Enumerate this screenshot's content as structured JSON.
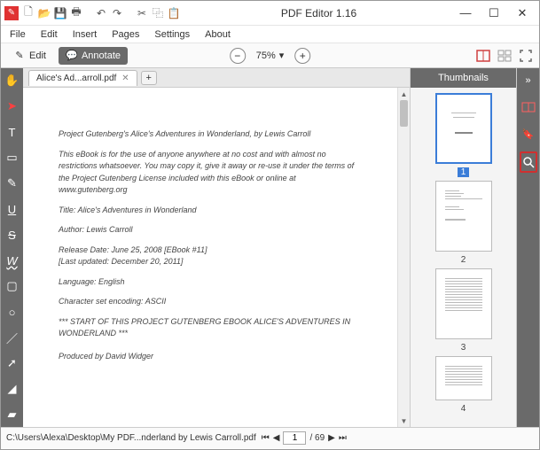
{
  "app": {
    "title": "PDF Editor 1.16"
  },
  "menu": {
    "items": [
      "File",
      "Edit",
      "Insert",
      "Pages",
      "Settings",
      "About"
    ]
  },
  "toolbar": {
    "edit": "Edit",
    "annotate": "Annotate",
    "zoom": "75%"
  },
  "tab": {
    "label": "Alice's Ad...arroll.pdf"
  },
  "doc": {
    "p1": "Project Gutenberg's Alice's Adventures in Wonderland, by Lewis Carroll",
    "p2": "This eBook is for the use of anyone anywhere at no cost and with almost no restrictions whatsoever.  You may copy it, give it away or re-use it under the terms of the Project Gutenberg License included with this eBook or online at www.gutenberg.org",
    "p3": "Title: Alice's Adventures in Wonderland",
    "p4": "Author: Lewis Carroll",
    "p5": "Release Date: June 25, 2008 [EBook #11]",
    "p6": "[Last updated: December 20, 2011]",
    "p7": "Language: English",
    "p8": "Character set encoding: ASCII",
    "p9": "*** START OF THIS PROJECT GUTENBERG EBOOK ALICE'S ADVENTURES IN WONDERLAND ***",
    "p10": "Produced by David Widger"
  },
  "thumbs": {
    "header": "Thumbnails",
    "n1": "1",
    "n2": "2",
    "n3": "3",
    "n4": "4"
  },
  "status": {
    "path": "C:\\Users\\Alexa\\Desktop\\My PDF...nderland by Lewis Carroll.pdf",
    "page": "1",
    "total": "/ 69"
  }
}
